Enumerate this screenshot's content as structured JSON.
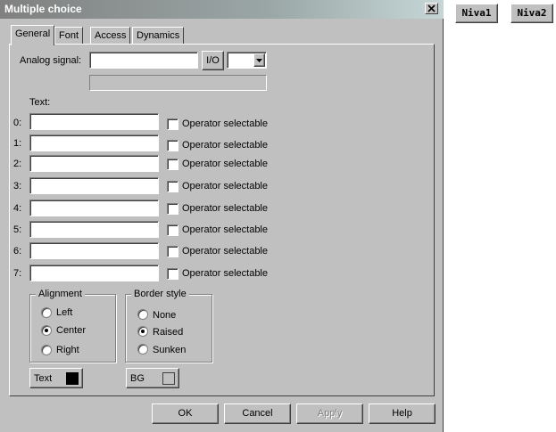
{
  "window": {
    "title": "Multiple choice"
  },
  "tabs": [
    {
      "label": "General",
      "active": true
    },
    {
      "label": "Font",
      "active": false
    },
    {
      "label": "Access",
      "active": false
    },
    {
      "label": "Dynamics",
      "active": false
    }
  ],
  "analog": {
    "label": "Analog signal:",
    "value": "",
    "io_button": "I/O",
    "dropdown_value": "",
    "info_value": ""
  },
  "text_section": {
    "label": "Text:",
    "rows": [
      {
        "index": "0:",
        "value": "",
        "checkbox_label": "Operator selectable",
        "checked": false
      },
      {
        "index": "1:",
        "value": "",
        "checkbox_label": "Operator selectable",
        "checked": false
      },
      {
        "index": "2:",
        "value": "",
        "checkbox_label": "Operator selectable",
        "checked": false
      },
      {
        "index": "3:",
        "value": "",
        "checkbox_label": "Operator selectable",
        "checked": false
      },
      {
        "index": "4:",
        "value": "",
        "checkbox_label": "Operator selectable",
        "checked": false
      },
      {
        "index": "5:",
        "value": "",
        "checkbox_label": "Operator selectable",
        "checked": false
      },
      {
        "index": "6:",
        "value": "",
        "checkbox_label": "Operator selectable",
        "checked": false
      },
      {
        "index": "7:",
        "value": "",
        "checkbox_label": "Operator selectable",
        "checked": false
      }
    ]
  },
  "alignment": {
    "label": "Alignment",
    "options": [
      {
        "label": "Left",
        "selected": false
      },
      {
        "label": "Center",
        "selected": true
      },
      {
        "label": "Right",
        "selected": false
      }
    ]
  },
  "border_style": {
    "label": "Border style",
    "options": [
      {
        "label": "None",
        "selected": false
      },
      {
        "label": "Raised",
        "selected": true
      },
      {
        "label": "Sunken",
        "selected": false
      }
    ]
  },
  "color_buttons": {
    "text": {
      "label": "Text",
      "color": "#000000"
    },
    "bg": {
      "label": "BG",
      "color": "#c0c0c0"
    }
  },
  "footer": {
    "ok": "OK",
    "cancel": "Cancel",
    "apply": "Apply",
    "help": "Help"
  },
  "external": {
    "niva1": "Niva1",
    "niva2": "Niva2"
  },
  "colors": {
    "face": "#c0c0c0",
    "titlebar_start": "#808080",
    "titlebar_end": "#c6d6d6"
  }
}
